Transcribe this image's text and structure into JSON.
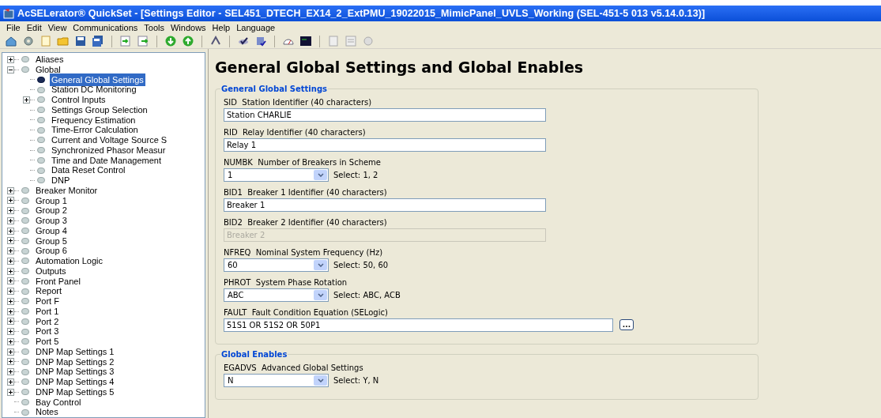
{
  "window": {
    "title": "AcSELerator® QuickSet - [Settings Editor - SEL451_DTECH_EX14_2_ExtPMU_19022015_MimicPanel_UVLS_Working (SEL-451-5 013 v5.14.0.13)]"
  },
  "menu": [
    "File",
    "Edit",
    "View",
    "Communications",
    "Tools",
    "Windows",
    "Help",
    "Language"
  ],
  "tree": [
    {
      "label": "Aliases",
      "expanded": false,
      "selected": false
    },
    {
      "label": "Global",
      "expanded": true,
      "selected": false,
      "children": [
        {
          "label": "General Global Settings",
          "selected": true
        },
        {
          "label": "Station DC Monitoring",
          "selected": false
        },
        {
          "label": "Control Inputs",
          "expanded": false,
          "selected": false
        },
        {
          "label": "Settings Group Selection",
          "selected": false
        },
        {
          "label": "Frequency Estimation",
          "selected": false
        },
        {
          "label": "Time-Error Calculation",
          "selected": false
        },
        {
          "label": "Current and Voltage Source S",
          "selected": false
        },
        {
          "label": "Synchronized Phasor Measur",
          "selected": false
        },
        {
          "label": "Time and Date Management",
          "selected": false
        },
        {
          "label": "Data Reset Control",
          "selected": false
        },
        {
          "label": "DNP",
          "selected": false
        }
      ]
    },
    {
      "label": "Breaker Monitor",
      "expanded": false,
      "selected": false
    },
    {
      "label": "Group 1",
      "expanded": false,
      "selected": false
    },
    {
      "label": "Group 2",
      "expanded": false,
      "selected": false
    },
    {
      "label": "Group 3",
      "expanded": false,
      "selected": false
    },
    {
      "label": "Group 4",
      "expanded": false,
      "selected": false
    },
    {
      "label": "Group 5",
      "expanded": false,
      "selected": false
    },
    {
      "label": "Group 6",
      "expanded": false,
      "selected": false
    },
    {
      "label": "Automation Logic",
      "expanded": false,
      "selected": false
    },
    {
      "label": "Outputs",
      "expanded": false,
      "selected": false
    },
    {
      "label": "Front Panel",
      "expanded": false,
      "selected": false
    },
    {
      "label": "Report",
      "expanded": false,
      "selected": false
    },
    {
      "label": "Port F",
      "expanded": false,
      "selected": false
    },
    {
      "label": "Port 1",
      "expanded": false,
      "selected": false
    },
    {
      "label": "Port 2",
      "expanded": false,
      "selected": false
    },
    {
      "label": "Port 3",
      "expanded": false,
      "selected": false
    },
    {
      "label": "Port 5",
      "expanded": false,
      "selected": false
    },
    {
      "label": "DNP Map Settings 1",
      "expanded": false,
      "selected": false
    },
    {
      "label": "DNP Map Settings 2",
      "expanded": false,
      "selected": false
    },
    {
      "label": "DNP Map Settings 3",
      "expanded": false,
      "selected": false
    },
    {
      "label": "DNP Map Settings 4",
      "expanded": false,
      "selected": false
    },
    {
      "label": "DNP Map Settings 5",
      "expanded": false,
      "selected": false
    },
    {
      "label": "Bay Control",
      "selected": false
    },
    {
      "label": "Notes",
      "selected": false
    }
  ],
  "editor": {
    "heading": "General Global Settings and Global Enables",
    "sections": [
      {
        "title": "General Global Settings",
        "fields": [
          {
            "kind": "text",
            "label": "SID  Station Identifier (40 characters)",
            "value": "Station CHARLIE",
            "disabled": false
          },
          {
            "kind": "text",
            "label": "RID  Relay Identifier (40 characters)",
            "value": "Relay 1",
            "disabled": false
          },
          {
            "kind": "select",
            "label": "NUMBK  Number of Breakers in Scheme",
            "value": "1",
            "hint": "Select: 1, 2"
          },
          {
            "kind": "text",
            "label": "BID1  Breaker 1 Identifier (40 characters)",
            "value": "Breaker 1",
            "disabled": false
          },
          {
            "kind": "text",
            "label": "BID2  Breaker 2 Identifier (40 characters)",
            "value": "Breaker 2",
            "disabled": true
          },
          {
            "kind": "select",
            "label": "NFREQ  Nominal System Frequency (Hz)",
            "value": "60",
            "hint": "Select: 50, 60"
          },
          {
            "kind": "select",
            "label": "PHROT  System Phase Rotation",
            "value": "ABC",
            "hint": "Select: ABC, ACB"
          },
          {
            "kind": "equation",
            "label": "FAULT  Fault Condition Equation (SELogic)",
            "value": "51S1 OR 51S2 OR 50P1",
            "button": "..."
          }
        ]
      },
      {
        "title": "Global Enables",
        "fields": [
          {
            "kind": "select",
            "label": "EGADVS  Advanced Global Settings",
            "value": "N",
            "hint": "Select: Y, N"
          }
        ]
      }
    ]
  }
}
